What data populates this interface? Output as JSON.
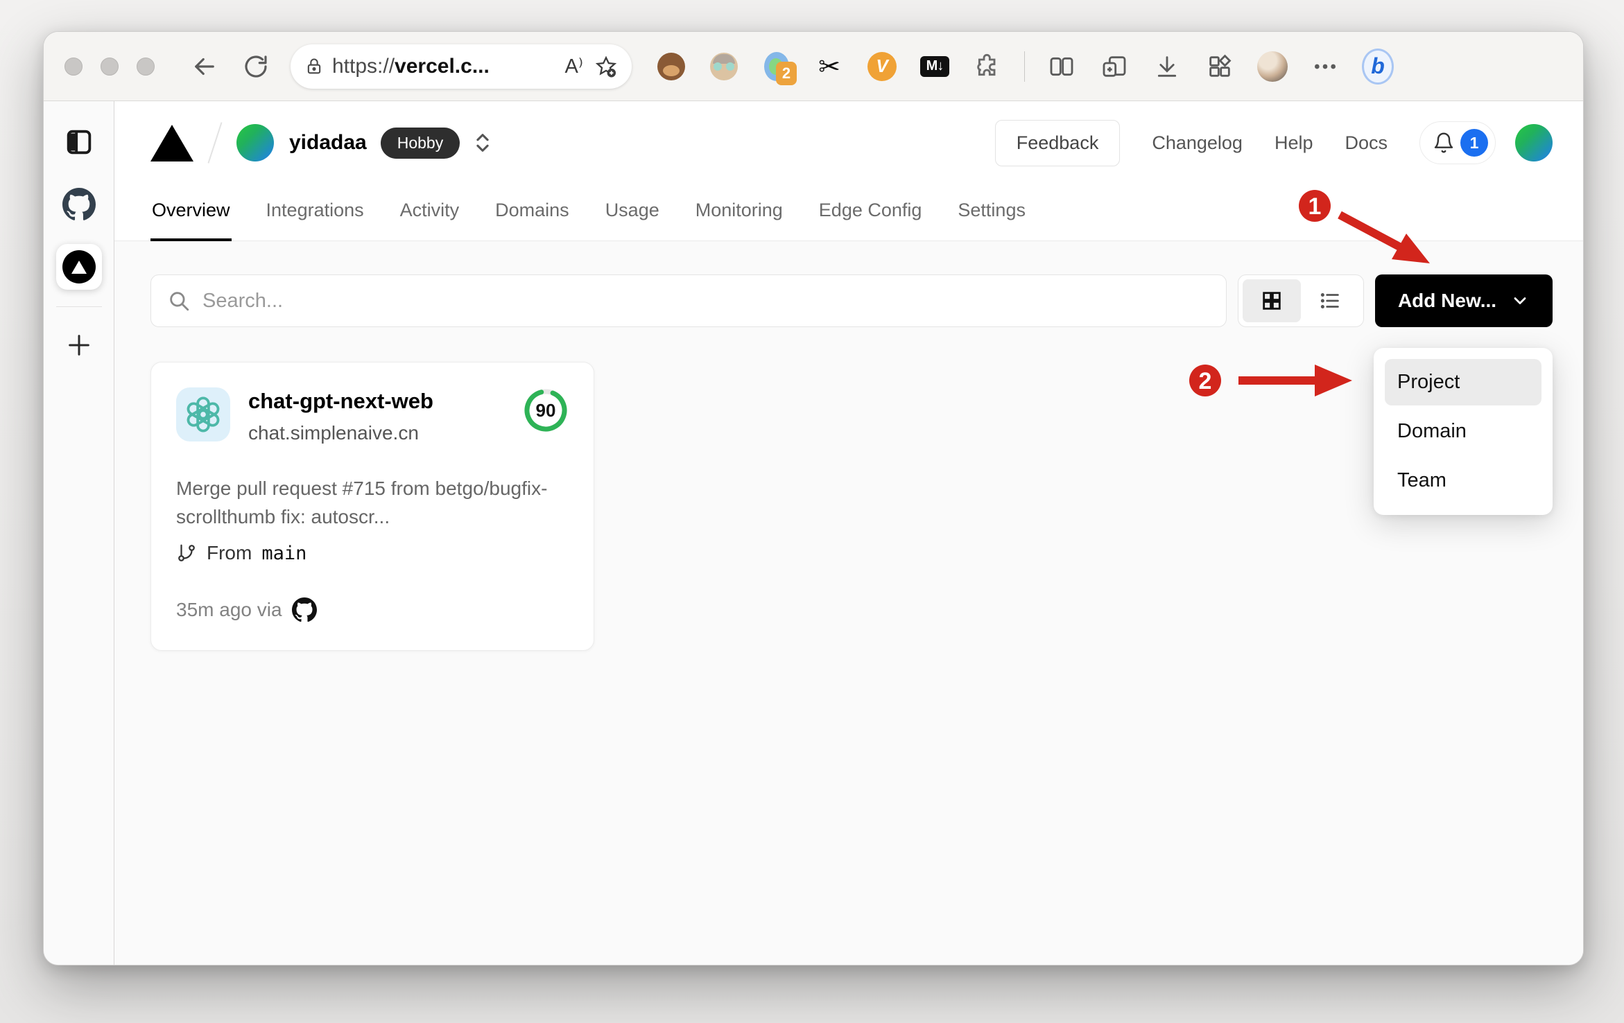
{
  "browser": {
    "address": {
      "scheme": "https://",
      "host_bold": "vercel.c...",
      "read_aloud_label": "A"
    },
    "extensions": {
      "tab_count_badge": "2",
      "v_label": "V",
      "markdown_label": "M↓",
      "scissors_glyph": "✂",
      "bing_label": "b"
    }
  },
  "vercel": {
    "account": {
      "name": "yidadaa",
      "plan": "Hobby"
    },
    "header_actions": {
      "feedback": "Feedback",
      "changelog": "Changelog",
      "help": "Help",
      "docs": "Docs",
      "notification_count": "1"
    },
    "nav": {
      "tabs": [
        {
          "label": "Overview",
          "active": true
        },
        {
          "label": "Integrations",
          "active": false
        },
        {
          "label": "Activity",
          "active": false
        },
        {
          "label": "Domains",
          "active": false
        },
        {
          "label": "Usage",
          "active": false
        },
        {
          "label": "Monitoring",
          "active": false
        },
        {
          "label": "Edge Config",
          "active": false
        },
        {
          "label": "Settings",
          "active": false
        }
      ]
    },
    "controls": {
      "search_placeholder": "Search...",
      "add_new_label": "Add New..."
    },
    "dropdown": {
      "items": [
        "Project",
        "Domain",
        "Team"
      ],
      "highlighted": "Project"
    },
    "project_card": {
      "name": "chat-gpt-next-web",
      "domain": "chat.simplenaive.cn",
      "score": "90",
      "commit_message": "Merge pull request #715 from betgo/bugfix-scrollthumb fix: autoscr...",
      "branch_label": "From",
      "branch_name": "main",
      "deployed": "35m ago via"
    }
  },
  "annotations": {
    "step1": "1",
    "step2": "2"
  },
  "colors": {
    "accent_red": "#d2251c",
    "score_green": "#2eb356",
    "notification_blue": "#1b6ff0",
    "button_black": "#000000",
    "openai_teal": "#4db8a8",
    "page_grey": "#fafafa"
  }
}
